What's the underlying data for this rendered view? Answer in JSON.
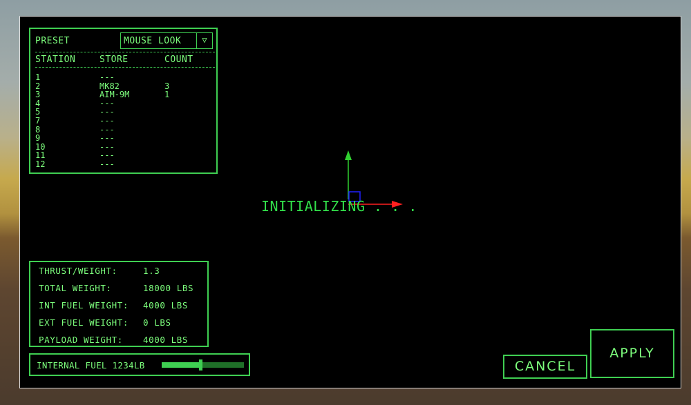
{
  "loadout": {
    "preset_label": "PRESET",
    "preset_value": "MOUSE LOOK",
    "dropdown_arrow": "▽",
    "columns": [
      "STATION",
      "STORE",
      "COUNT"
    ],
    "rows": [
      {
        "station": "1",
        "store": "---",
        "count": ""
      },
      {
        "station": "2",
        "store": "MK82",
        "count": "3"
      },
      {
        "station": "3",
        "store": "AIM-9M",
        "count": "1"
      },
      {
        "station": "4",
        "store": "---",
        "count": ""
      },
      {
        "station": "5",
        "store": "---",
        "count": ""
      },
      {
        "station": "7",
        "store": "---",
        "count": ""
      },
      {
        "station": "8",
        "store": "---",
        "count": ""
      },
      {
        "station": "9",
        "store": "---",
        "count": ""
      },
      {
        "station": "10",
        "store": "---",
        "count": ""
      },
      {
        "station": "11",
        "store": "---",
        "count": ""
      },
      {
        "station": "12",
        "store": "---",
        "count": ""
      }
    ]
  },
  "stats": {
    "thrust_weight_label": "THRUST/WEIGHT:",
    "thrust_weight_value": "1.3",
    "total_weight_label": "TOTAL WEIGHT:",
    "total_weight_value": "18000 LBS",
    "int_fuel_label": "INT FUEL WEIGHT:",
    "int_fuel_value": "4000 LBS",
    "ext_fuel_label": "EXT FUEL WEIGHT:",
    "ext_fuel_value": "0 LBS",
    "payload_label": "PAYLOAD WEIGHT:",
    "payload_value": "4000 LBS"
  },
  "fuel": {
    "label": "INTERNAL FUEL",
    "value": "1234LB",
    "slider_fraction": 0.47
  },
  "status_text": "INITIALIZING . . .",
  "buttons": {
    "cancel": "CANCEL",
    "apply": "APPLY"
  },
  "colors": {
    "accent": "#3fcf52",
    "text": "#7dff7d",
    "background": "#000000",
    "gizmo_x": "#ff2020",
    "gizmo_y": "#30d030",
    "gizmo_z": "#2020ff"
  }
}
